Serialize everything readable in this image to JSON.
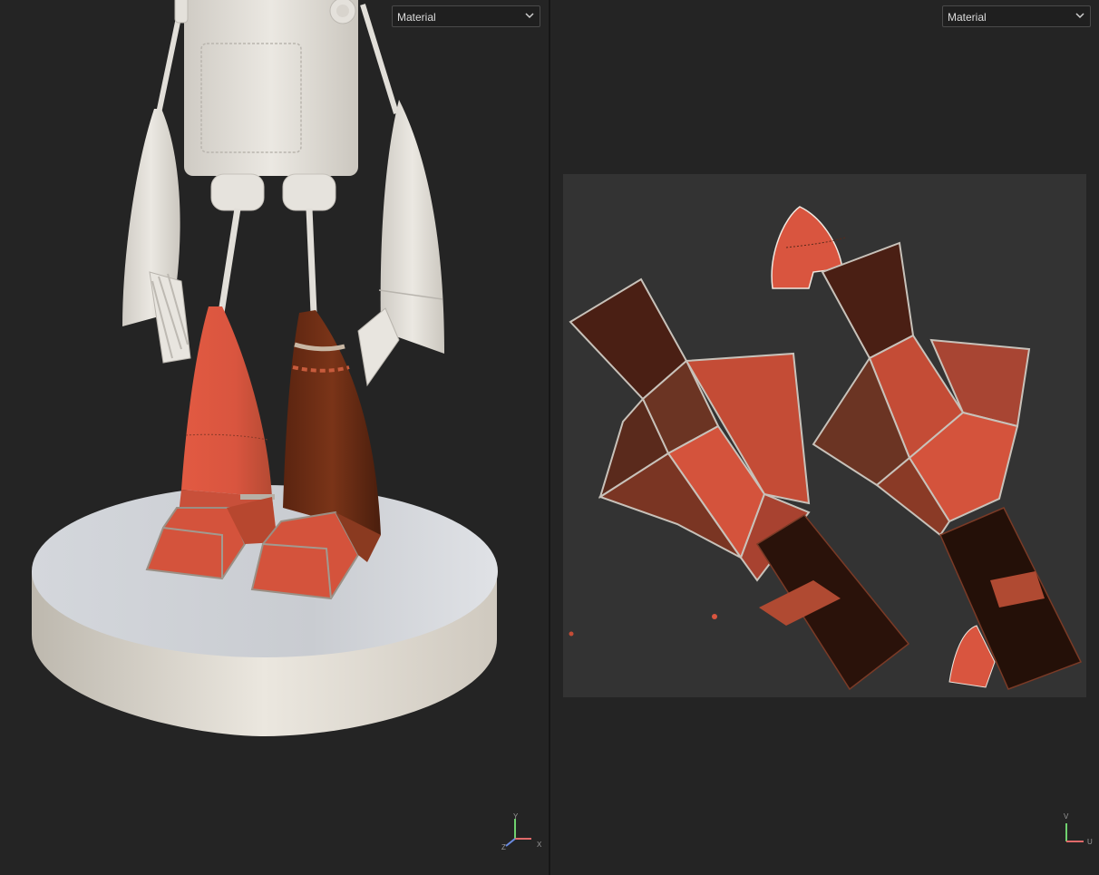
{
  "left_viewport": {
    "dropdown_value": "Material",
    "axis_labels": {
      "y": "Y",
      "x": "X",
      "z": "Z"
    }
  },
  "right_viewport": {
    "dropdown_value": "Material",
    "axis_labels": {
      "v": "V",
      "u": "U"
    }
  },
  "colors": {
    "background": "#242424",
    "uv_canvas": "#333333",
    "base_plate": "#d8d5cf",
    "robot_clay": "#e6e3dd",
    "paint_red": "#d9553f",
    "paint_brown": "#6b2e16",
    "axis_y": "#6fd16f",
    "axis_x": "#e06a6a",
    "axis_z": "#6a8ae0"
  }
}
